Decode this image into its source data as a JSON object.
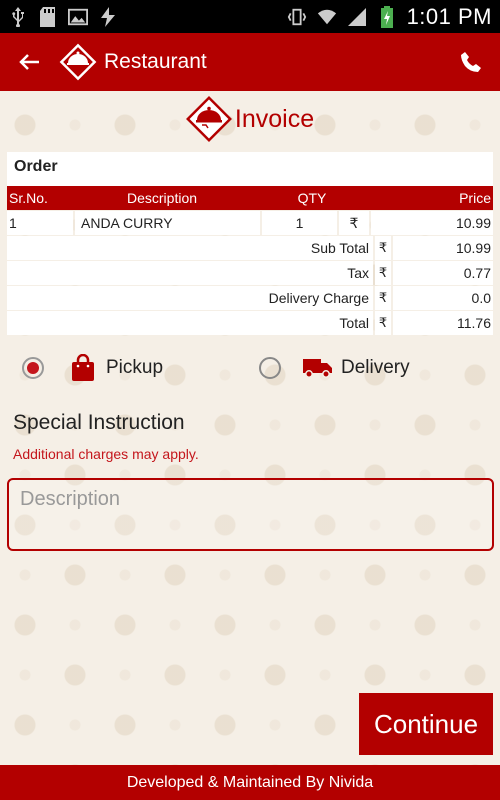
{
  "status_bar": {
    "time": "1:01 PM",
    "icons_left": [
      "usb-icon",
      "sd-card-icon",
      "image-icon",
      "sync-icon"
    ],
    "icons_right": [
      "vibrate-icon",
      "wifi-icon",
      "signal-icon",
      "battery-charging-icon"
    ]
  },
  "app_bar": {
    "title": "Restaurant",
    "icons": [
      "back-arrow-icon",
      "cloche-logo-icon",
      "phone-icon"
    ]
  },
  "invoice": {
    "title": "Invoice"
  },
  "order": {
    "heading": "Order",
    "columns": [
      "Sr.No.",
      "Description",
      "QTY",
      "Price"
    ],
    "items": [
      {
        "sr": "1",
        "description": "ANDA CURRY",
        "qty": "1",
        "currency": "₹",
        "price": "10.99"
      }
    ],
    "summary": [
      {
        "label": "Sub Total",
        "currency": "₹",
        "value": "10.99"
      },
      {
        "label": "Tax",
        "currency": "₹",
        "value": "0.77"
      },
      {
        "label": "Delivery Charge",
        "currency": "₹",
        "value": "0.0"
      },
      {
        "label": "Total",
        "currency": "₹",
        "value": "11.76"
      }
    ]
  },
  "options": {
    "pickup": {
      "label": "Pickup",
      "selected": true,
      "icon": "shopping-bag-icon"
    },
    "delivery": {
      "label": "Delivery",
      "selected": false,
      "icon": "truck-icon"
    }
  },
  "special": {
    "title": "Special Instruction",
    "note": "Additional charges may apply.",
    "placeholder": "Description"
  },
  "continue_label": "Continue",
  "footer": "Developed & Maintained By Nivida",
  "colors": {
    "primary": "#b30000",
    "accent": "#c4161c",
    "background": "#f5efe6"
  }
}
